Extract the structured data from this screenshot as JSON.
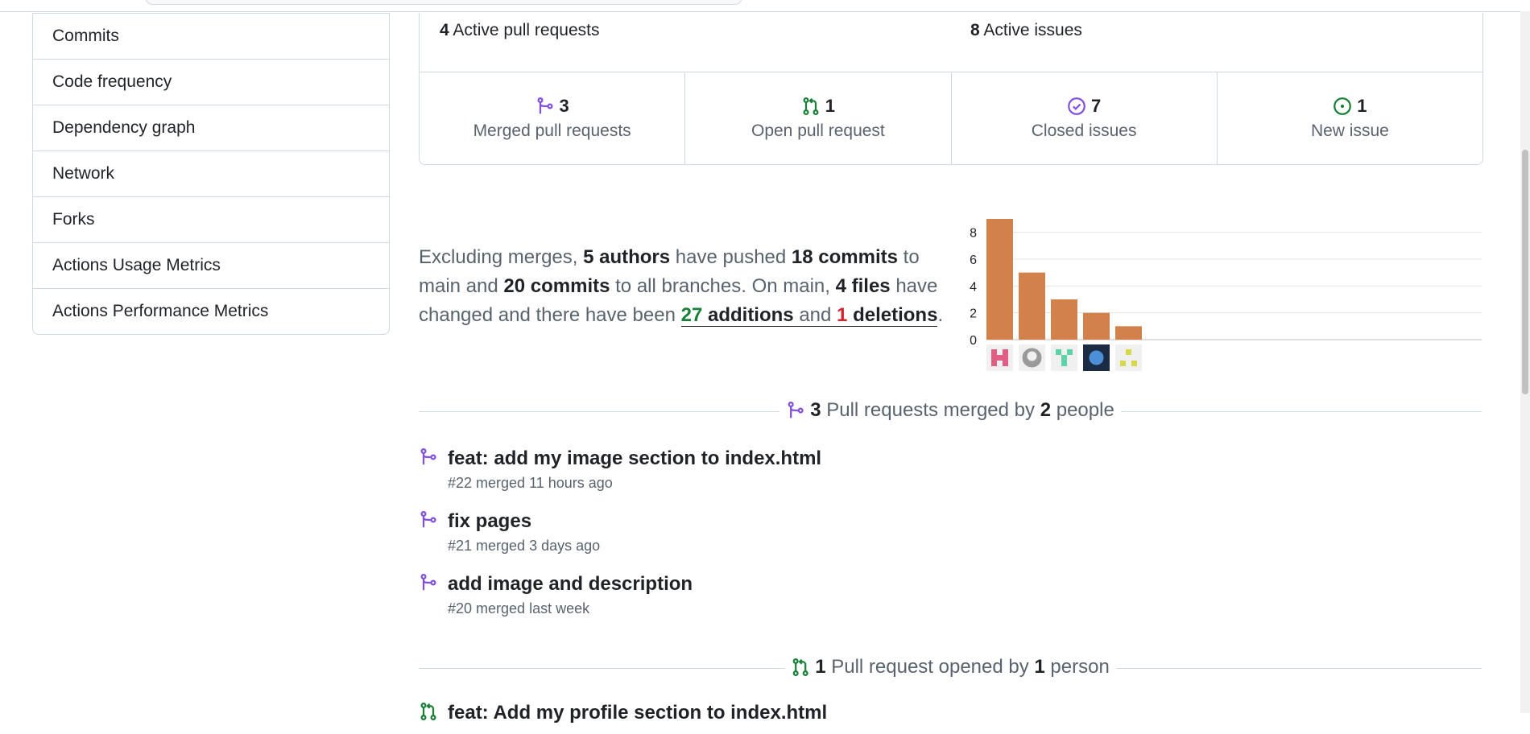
{
  "sidebar": {
    "items": [
      {
        "label": "Commits"
      },
      {
        "label": "Code frequency"
      },
      {
        "label": "Dependency graph"
      },
      {
        "label": "Network"
      },
      {
        "label": "Forks"
      },
      {
        "label": "Actions Usage Metrics"
      },
      {
        "label": "Actions Performance Metrics"
      }
    ]
  },
  "summary": {
    "active_prs_count": "4",
    "active_prs_label": "Active pull requests",
    "active_issues_count": "8",
    "active_issues_label": "Active issues",
    "stats": [
      {
        "count": "3",
        "label": "Merged pull requests",
        "icon": "merge-icon",
        "color": "#8250df"
      },
      {
        "count": "1",
        "label": "Open pull request",
        "icon": "pull-request-icon",
        "color": "#1a7f37"
      },
      {
        "count": "7",
        "label": "Closed issues",
        "icon": "issue-closed-icon",
        "color": "#8250df"
      },
      {
        "count": "1",
        "label": "New issue",
        "icon": "issue-opened-icon",
        "color": "#1a7f37"
      }
    ]
  },
  "sentence": {
    "p1": "Excluding merges, ",
    "authors": "5 authors",
    "p2": " have pushed ",
    "commits_main": "18 commits",
    "p3": " to main and ",
    "commits_all": "20 commits",
    "p4": " to all branches. On main, ",
    "files": "4 files",
    "p5": " have changed and there have been ",
    "additions_count": "27",
    "additions_word": " additions",
    "and_word": " and ",
    "deletions_count": "1",
    "deletions_word": " deletions",
    "end": "."
  },
  "chart_data": {
    "type": "bar",
    "categories": [
      "author-1",
      "author-2",
      "author-3",
      "author-4",
      "author-5"
    ],
    "values": [
      9,
      5,
      3,
      2,
      1
    ],
    "yticks": [
      "0",
      "2",
      "4",
      "6",
      "8"
    ],
    "ylim": [
      0,
      9
    ],
    "grid": true,
    "bar_color": "#d2814b",
    "avatar_icons": [
      "pink-identicon-avatar",
      "github-default-avatar",
      "green-identicon-avatar",
      "photo-avatar",
      "yellow-identicon-avatar"
    ]
  },
  "merged_section": {
    "count": "3",
    "text1": " Pull requests merged by ",
    "people": "2",
    "text2": " people"
  },
  "merged_prs": [
    {
      "title": "feat: add my image section to index.html",
      "meta": "#22 merged 11 hours ago"
    },
    {
      "title": "fix pages",
      "meta": "#21 merged 3 days ago"
    },
    {
      "title": "add image and description",
      "meta": "#20 merged last week"
    }
  ],
  "opened_section": {
    "count": "1",
    "text1": " Pull request opened by ",
    "people": "1",
    "text2": " person"
  },
  "opened_prs": [
    {
      "title": "feat: Add my profile section to index.html"
    }
  ]
}
